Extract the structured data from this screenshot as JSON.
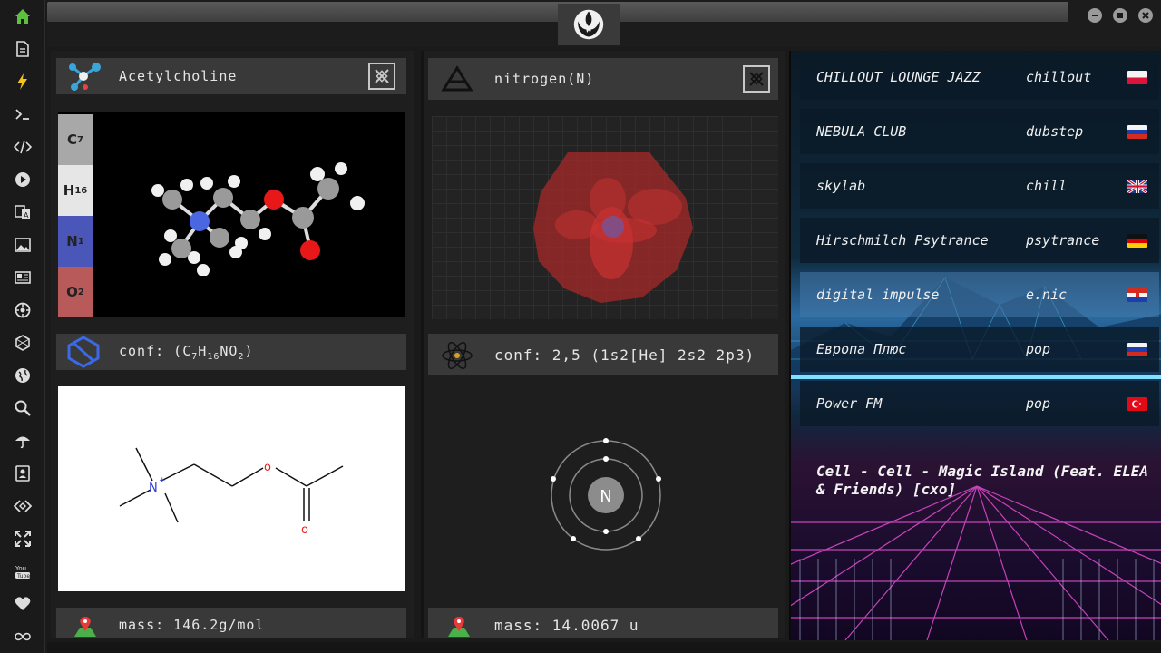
{
  "sidebar": {
    "icons": [
      "home-icon",
      "document-icon",
      "lightning-icon",
      "terminal-icon",
      "code-icon",
      "play-icon",
      "translate-icon",
      "image-icon",
      "news-icon",
      "settings-icon",
      "hexagon-icon",
      "globe-icon",
      "search-icon",
      "umbrella-icon",
      "contact-icon",
      "tag-code-icon",
      "expand-icon",
      "youtube-icon",
      "heart-icon",
      "infinity-icon"
    ],
    "active_color": "#5fbf3f"
  },
  "molecule": {
    "title": "Acetylcholine",
    "formula_strip": [
      {
        "element": "C",
        "count": "7",
        "color": "#a8a8a8"
      },
      {
        "element": "H",
        "count": "16",
        "color": "#e6e6e6"
      },
      {
        "element": "N",
        "count": "1",
        "color": "#4a56b8"
      },
      {
        "element": "O",
        "count": "2",
        "color": "#b85a5a"
      }
    ],
    "conf_prefix": "conf: (C",
    "conf_c": "7",
    "conf_h_prefix": "H",
    "conf_h": "16",
    "conf_no_prefix": "NO",
    "conf_o": "2",
    "conf_suffix": ")",
    "mass": "mass: 146.2g/mol",
    "structure_labels": {
      "n": "N",
      "plus": "+",
      "o1": "o",
      "o2": "o"
    }
  },
  "element": {
    "title": "nitrogen(N)",
    "conf": "conf: 2,5 (1s2[He] 2s2 2p3)",
    "symbol": "N",
    "mass": "mass: 14.0067 u"
  },
  "radio": {
    "stations": [
      {
        "name": "CHILLOUT LOUNGE JAZZ",
        "genre": "chillout",
        "flag": "pl"
      },
      {
        "name": "NEBULA CLUB",
        "genre": "dubstep",
        "flag": "ru"
      },
      {
        "name": "skylab",
        "genre": "chill",
        "flag": "gb"
      },
      {
        "name": "Hirschmilch Psytrance",
        "genre": "psytrance",
        "flag": "de"
      },
      {
        "name": "digital impulse",
        "genre": "e.nic",
        "flag": "hr"
      },
      {
        "name": "Европа Плюс",
        "genre": "pop",
        "flag": "ru"
      },
      {
        "name": "Power FM",
        "genre": "pop",
        "flag": "tr"
      }
    ],
    "selected_index": 4,
    "now_playing": "Cell - Cell - Magic Island (Feat. ELEA & Friends) [cxo]"
  }
}
